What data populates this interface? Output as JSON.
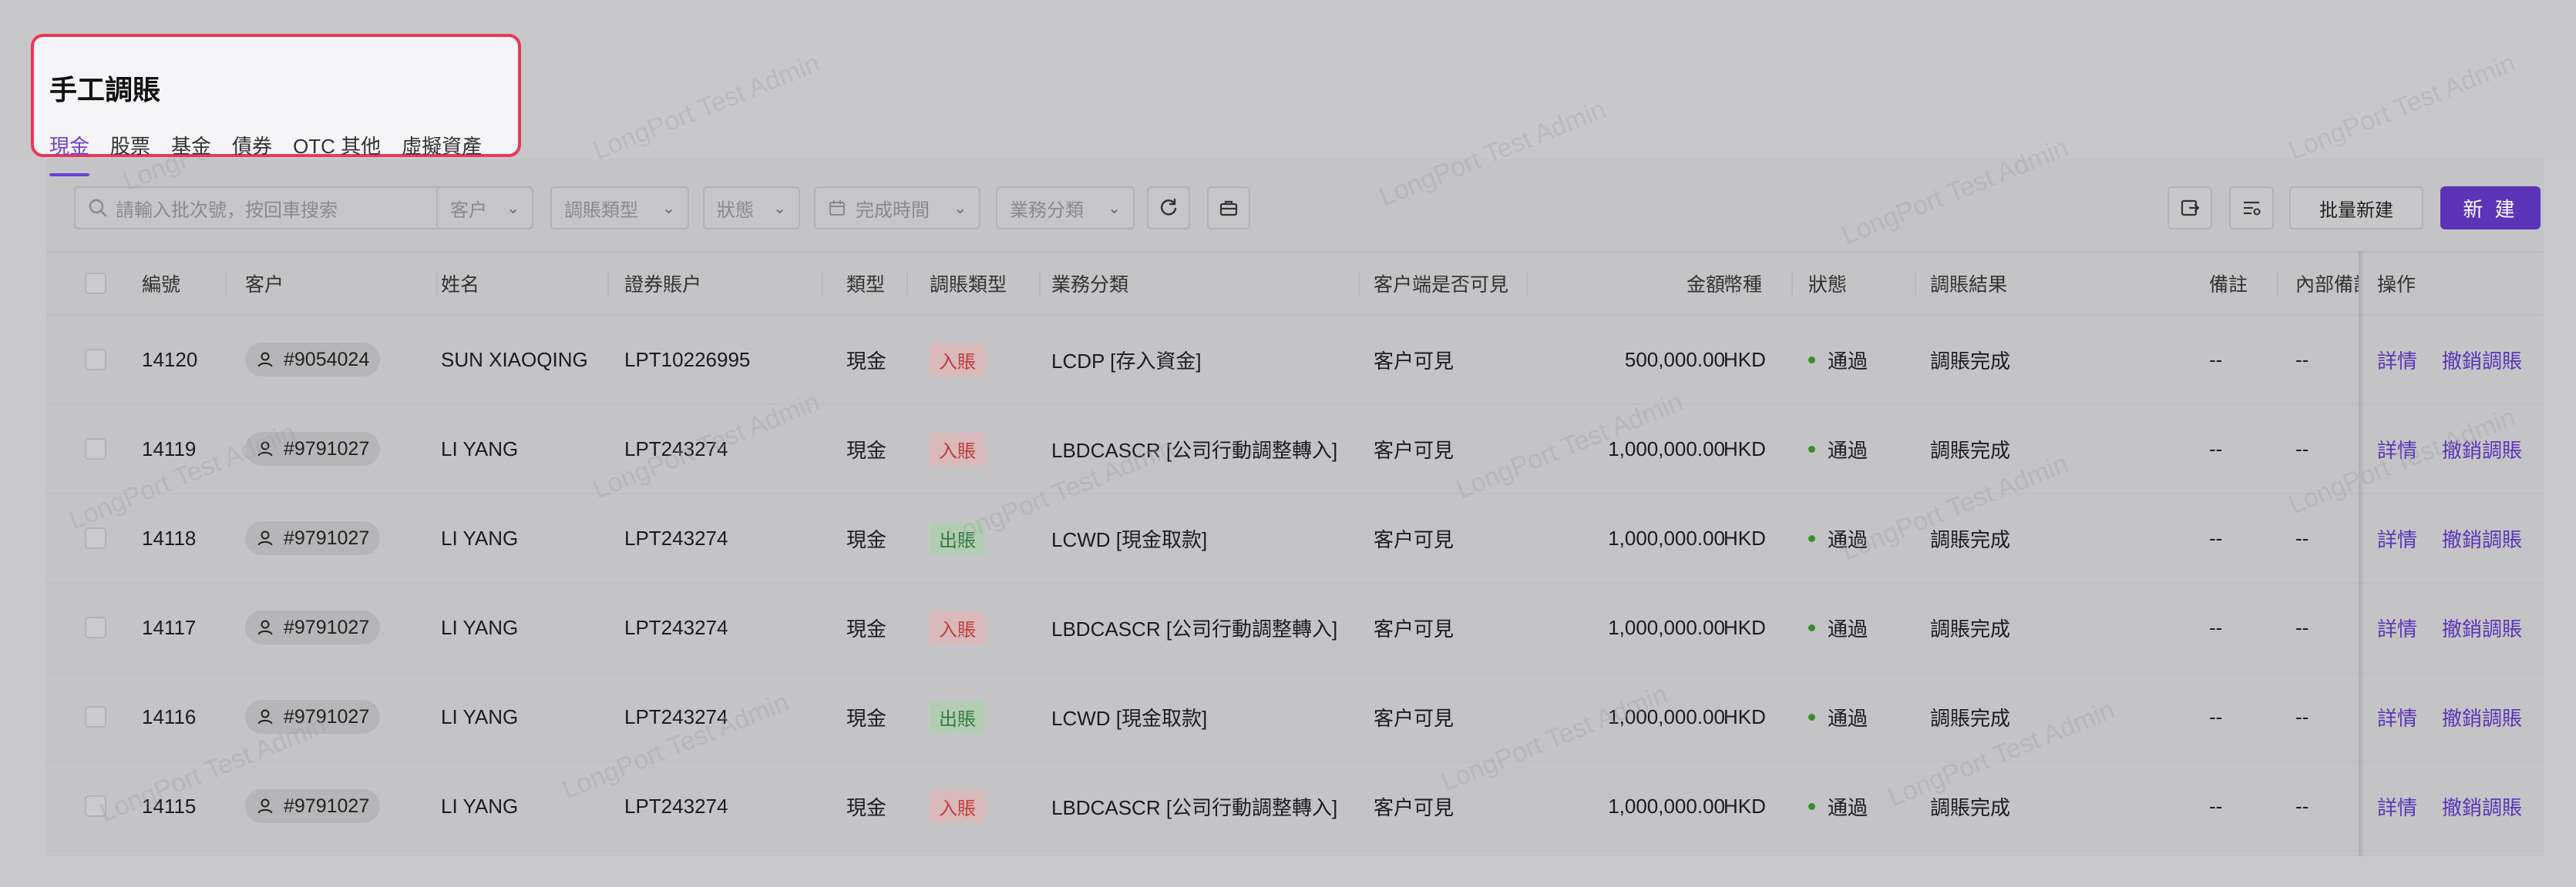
{
  "page": {
    "title": "手工調賬",
    "tabs": [
      "現金",
      "股票",
      "基金",
      "債券",
      "OTC 其他",
      "虛擬資產"
    ],
    "active_tab": "現金",
    "watermark_text": "LongPort Test Admin"
  },
  "filters": {
    "search_placeholder": "請輸入批次號，按回車搜索",
    "customer": "客户",
    "adjust_type": "調賬類型",
    "status": "狀態",
    "complete_time": "完成時間",
    "business_category": "業務分類"
  },
  "actions": {
    "batch_new": "批量新建",
    "new": "新 建"
  },
  "table": {
    "headers": {
      "id": "編號",
      "customer": "客户",
      "name": "姓名",
      "account": "證券賬户",
      "type": "類型",
      "adjust_type": "調賬類型",
      "business_category": "業務分類",
      "client_visible": "客户端是否可見",
      "amount": "金額",
      "currency": "幣種",
      "status": "狀態",
      "result": "調賬結果",
      "remark": "備註",
      "internal_remark": "內部備註",
      "operation": "操作"
    },
    "rows": [
      {
        "id": "14120",
        "customer": "#9054024",
        "name": "SUN XIAOQING",
        "account": "LPT10226995",
        "type": "現金",
        "adjust_type": "入賬",
        "direction": "in",
        "business_category": "LCDP [存入資金]",
        "client_visible": "客户可見",
        "amount": "500,000.00",
        "currency": "HKD",
        "status": "通過",
        "result": "調賬完成",
        "remark": "--",
        "internal_remark": "--",
        "op_detail": "詳情",
        "op_cancel": "撤銷調賬"
      },
      {
        "id": "14119",
        "customer": "#9791027",
        "name": "LI YANG",
        "account": "LPT243274",
        "type": "現金",
        "adjust_type": "入賬",
        "direction": "in",
        "business_category": "LBDCASCR [公司行動調整轉入]",
        "client_visible": "客户可見",
        "amount": "1,000,000.00",
        "currency": "HKD",
        "status": "通過",
        "result": "調賬完成",
        "remark": "--",
        "internal_remark": "--",
        "op_detail": "詳情",
        "op_cancel": "撤銷調賬"
      },
      {
        "id": "14118",
        "customer": "#9791027",
        "name": "LI YANG",
        "account": "LPT243274",
        "type": "現金",
        "adjust_type": "出賬",
        "direction": "out",
        "business_category": "LCWD [現金取款]",
        "client_visible": "客户可見",
        "amount": "1,000,000.00",
        "currency": "HKD",
        "status": "通過",
        "result": "調賬完成",
        "remark": "--",
        "internal_remark": "--",
        "op_detail": "詳情",
        "op_cancel": "撤銷調賬"
      },
      {
        "id": "14117",
        "customer": "#9791027",
        "name": "LI YANG",
        "account": "LPT243274",
        "type": "現金",
        "adjust_type": "入賬",
        "direction": "in",
        "business_category": "LBDCASCR [公司行動調整轉入]",
        "client_visible": "客户可見",
        "amount": "1,000,000.00",
        "currency": "HKD",
        "status": "通過",
        "result": "調賬完成",
        "remark": "--",
        "internal_remark": "--",
        "op_detail": "詳情",
        "op_cancel": "撤銷調賬"
      },
      {
        "id": "14116",
        "customer": "#9791027",
        "name": "LI YANG",
        "account": "LPT243274",
        "type": "現金",
        "adjust_type": "出賬",
        "direction": "out",
        "business_category": "LCWD [現金取款]",
        "client_visible": "客户可見",
        "amount": "1,000,000.00",
        "currency": "HKD",
        "status": "通過",
        "result": "調賬完成",
        "remark": "--",
        "internal_remark": "--",
        "op_detail": "詳情",
        "op_cancel": "撤銷調賬"
      },
      {
        "id": "14115",
        "customer": "#9791027",
        "name": "LI YANG",
        "account": "LPT243274",
        "type": "現金",
        "adjust_type": "入賬",
        "direction": "in",
        "business_category": "LBDCASCR [公司行動調整轉入]",
        "client_visible": "客户可見",
        "amount": "1,000,000.00",
        "currency": "HKD",
        "status": "通過",
        "result": "調賬完成",
        "remark": "--",
        "internal_remark": "--",
        "op_detail": "詳情",
        "op_cancel": "撤銷調賬"
      }
    ]
  },
  "colors": {
    "accent": "#5b34b8",
    "highlight_border": "#e8385a",
    "status_ok": "#3c8c2d",
    "tag_in": "#c43a3a",
    "tag_out": "#2f7d3b"
  },
  "icons": [
    "search-icon",
    "chevron-down-icon",
    "calendar-icon",
    "refresh-icon",
    "briefcase-icon",
    "export-icon",
    "column-settings-icon",
    "user-icon"
  ]
}
